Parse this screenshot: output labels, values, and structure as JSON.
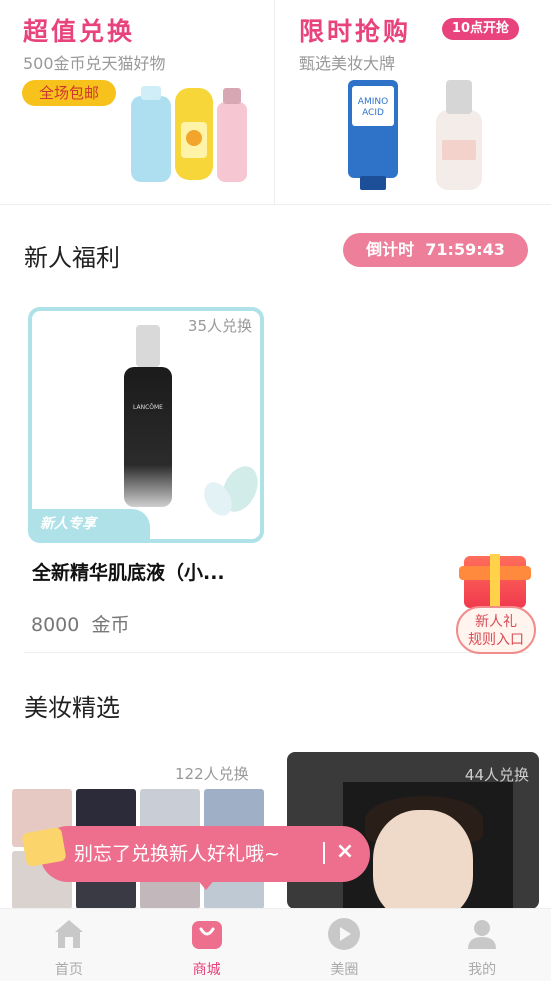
{
  "promos": {
    "left": {
      "title": "超值兑换",
      "subtitle": "500金币兑天猫好物",
      "badge": "全场包邮"
    },
    "right": {
      "title": "限时抢购",
      "subtitle": "甄选美妆大牌",
      "badge": "10点开抢"
    }
  },
  "newbie": {
    "title": "新人福利",
    "countdown_label": "倒计时",
    "countdown_value": "71:59:43",
    "product": {
      "redeem_count": "35人兑换",
      "tag": "新人专享",
      "brand": "LANCÔME",
      "name": "全新精华肌底液（小...",
      "price": "8000",
      "price_unit": "金币"
    }
  },
  "gift": {
    "line1": "新人礼",
    "line2": "规则入口"
  },
  "beauty": {
    "title": "美妆精选",
    "left_count": "122人兑换",
    "right_count": "44人兑换"
  },
  "toast": {
    "text": "别忘了兑换新人好礼哦~",
    "close": "×"
  },
  "nav": {
    "items": [
      {
        "label": "首页",
        "icon": "home-icon"
      },
      {
        "label": "商城",
        "icon": "shopping-bag-icon"
      },
      {
        "label": "美圈",
        "icon": "play-icon"
      },
      {
        "label": "我的",
        "icon": "user-icon"
      }
    ],
    "active_index": 1
  },
  "colors": {
    "accent": "#e8437c",
    "mint": "#aee1e8",
    "countdown": "#ee7f9b",
    "toast": "#ee6e8e"
  }
}
